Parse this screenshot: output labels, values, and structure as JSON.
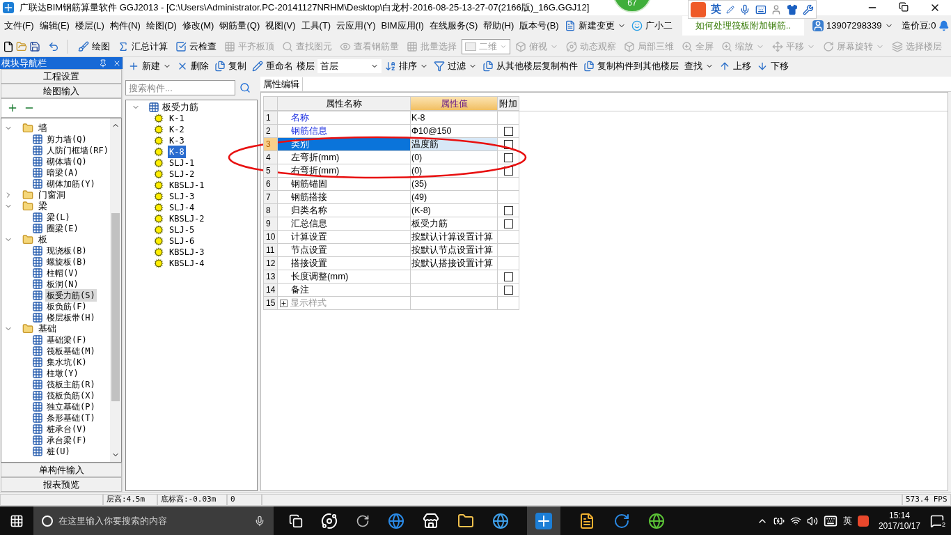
{
  "window": {
    "title": "广联达BIM钢筋算量软件 GGJ2013 - [C:\\Users\\Administrator.PC-20141127NRHM\\Desktop\\白龙村-2016-08-25-13-27-07(2166版)_16G.GGJ12]"
  },
  "badge": "67",
  "ime": {
    "mode": "英"
  },
  "menu": [
    "文件(F)",
    "编辑(E)",
    "楼层(L)",
    "构件(N)",
    "绘图(D)",
    "修改(M)",
    "钢筋量(Q)",
    "视图(V)",
    "工具(T)",
    "云应用(Y)",
    "BIM应用(I)",
    "在线服务(S)",
    "帮助(H)",
    "版本号(B)"
  ],
  "menu_extras": {
    "change": "新建变更",
    "assistant": "广小二",
    "notice": "如何处理筏板附加钢筋..",
    "account": "13907298339",
    "beans": "造价豆:0"
  },
  "toolbar": [
    {
      "kind": "button",
      "label": "绘图",
      "disabled": false
    },
    {
      "kind": "button",
      "label": "汇总计算",
      "disabled": false
    },
    {
      "kind": "button",
      "label": "云检查",
      "disabled": false
    },
    {
      "kind": "button",
      "label": "平齐板顶",
      "disabled": true
    },
    {
      "kind": "button",
      "label": "查找图元",
      "disabled": true
    },
    {
      "kind": "button",
      "label": "查看钢筋量",
      "disabled": true
    },
    {
      "kind": "button",
      "label": "批量选择",
      "disabled": true
    },
    {
      "kind": "select",
      "label": "二维",
      "disabled": true
    },
    {
      "kind": "dropdown",
      "label": "俯视",
      "disabled": true
    },
    {
      "kind": "button",
      "label": "动态观察",
      "disabled": true
    },
    {
      "kind": "button",
      "label": "局部三维",
      "disabled": true
    },
    {
      "kind": "button",
      "label": "全屏",
      "disabled": true
    },
    {
      "kind": "dropdown",
      "label": "缩放",
      "disabled": true
    },
    {
      "kind": "dropdown",
      "label": "平移",
      "disabled": true
    },
    {
      "kind": "dropdown",
      "label": "屏幕旋转",
      "disabled": true
    },
    {
      "kind": "button",
      "label": "选择楼层",
      "disabled": true
    }
  ],
  "nav": {
    "title": "模块导航栏",
    "sections_top": [
      "工程设置",
      "绘图输入"
    ],
    "sections_bottom": [
      "单构件输入",
      "报表预览"
    ],
    "tree": [
      {
        "label": "墙",
        "expanded": true,
        "selected": false,
        "children": [
          {
            "label": "剪力墙(Q)",
            "selected": false
          },
          {
            "label": "人防门框墙(RF)",
            "selected": false
          },
          {
            "label": "砌体墙(Q)",
            "selected": false
          },
          {
            "label": "暗梁(A)",
            "selected": false
          },
          {
            "label": "砌体加筋(Y)",
            "selected": false
          }
        ]
      },
      {
        "label": "门窗洞",
        "expanded": false,
        "selected": false
      },
      {
        "label": "梁",
        "expanded": true,
        "selected": false,
        "children": [
          {
            "label": "梁(L)",
            "selected": false
          },
          {
            "label": "圈梁(E)",
            "selected": false
          }
        ]
      },
      {
        "label": "板",
        "expanded": true,
        "selected": false,
        "children": [
          {
            "label": "现浇板(B)",
            "selected": false
          },
          {
            "label": "螺旋板(B)",
            "selected": false
          },
          {
            "label": "柱帽(V)",
            "selected": false
          },
          {
            "label": "板洞(N)",
            "selected": false
          },
          {
            "label": "板受力筋(S)",
            "selected": true
          },
          {
            "label": "板负筋(F)",
            "selected": false
          },
          {
            "label": "楼层板带(H)",
            "selected": false
          }
        ]
      },
      {
        "label": "基础",
        "expanded": true,
        "selected": false,
        "children": [
          {
            "label": "基础梁(F)",
            "selected": false
          },
          {
            "label": "筏板基础(M)",
            "selected": false
          },
          {
            "label": "集水坑(K)",
            "selected": false
          },
          {
            "label": "柱墩(Y)",
            "selected": false
          },
          {
            "label": "筏板主筋(R)",
            "selected": false
          },
          {
            "label": "筏板负筋(X)",
            "selected": false
          },
          {
            "label": "独立基础(P)",
            "selected": false
          },
          {
            "label": "条形基础(T)",
            "selected": false
          },
          {
            "label": "桩承台(V)",
            "selected": false
          },
          {
            "label": "承台梁(F)",
            "selected": false
          },
          {
            "label": "桩(U)",
            "selected": false
          }
        ]
      }
    ]
  },
  "component_toolbar": {
    "items": [
      {
        "kind": "dropdown",
        "label": "新建"
      },
      {
        "kind": "button",
        "label": "删除"
      },
      {
        "kind": "button",
        "label": "复制"
      },
      {
        "kind": "button",
        "label": "重命名"
      },
      {
        "kind": "floor",
        "label": "楼层",
        "value": "首层"
      },
      {
        "kind": "dropdown",
        "label": "排序"
      },
      {
        "kind": "dropdown",
        "label": "过滤"
      },
      {
        "kind": "button",
        "label": "从其他楼层复制构件"
      },
      {
        "kind": "button",
        "label": "复制构件到其他楼层"
      },
      {
        "kind": "dropdown",
        "label": "查找"
      },
      {
        "kind": "button",
        "label": "上移"
      },
      {
        "kind": "button",
        "label": "下移"
      }
    ]
  },
  "component_list": {
    "search_placeholder": "搜索构件...",
    "root": {
      "label": "板受力筋",
      "expanded": true,
      "children": [
        {
          "label": "K-1",
          "selected": false
        },
        {
          "label": "K-2",
          "selected": false
        },
        {
          "label": "K-3",
          "selected": false
        },
        {
          "label": "K-8",
          "selected": true
        },
        {
          "label": "SLJ-1",
          "selected": false
        },
        {
          "label": "SLJ-2",
          "selected": false
        },
        {
          "label": "KBSLJ-1",
          "selected": false
        },
        {
          "label": "SLJ-3",
          "selected": false
        },
        {
          "label": "SLJ-4",
          "selected": false
        },
        {
          "label": "KBSLJ-2",
          "selected": false
        },
        {
          "label": "SLJ-5",
          "selected": false
        },
        {
          "label": "SLJ-6",
          "selected": false
        },
        {
          "label": "KBSLJ-3",
          "selected": false
        },
        {
          "label": "KBSLJ-4",
          "selected": false
        }
      ]
    }
  },
  "properties": {
    "tab": "属性编辑",
    "columns": [
      "属性名称",
      "属性值",
      "附加"
    ],
    "rows": [
      {
        "num": "1",
        "name": "名称",
        "value": "K-8",
        "kind": "key",
        "selected": false
      },
      {
        "num": "2",
        "name": "钢筋信息",
        "value": "Φ10@150",
        "kind": "key",
        "selected": false,
        "checked": false
      },
      {
        "num": "3",
        "name": "类别",
        "value": "温度筋",
        "kind": "plain",
        "selected": true,
        "checked": false
      },
      {
        "num": "4",
        "name": "左弯折(mm)",
        "value": "(0)",
        "kind": "plain",
        "selected": false,
        "checked": false
      },
      {
        "num": "5",
        "name": "右弯折(mm)",
        "value": "(0)",
        "kind": "plain",
        "selected": false,
        "checked": false
      },
      {
        "num": "6",
        "name": "钢筋锚固",
        "value": "(35)",
        "kind": "plain",
        "selected": false
      },
      {
        "num": "7",
        "name": "钢筋搭接",
        "value": "(49)",
        "kind": "plain",
        "selected": false
      },
      {
        "num": "8",
        "name": "归类名称",
        "value": "(K-8)",
        "kind": "plain",
        "selected": false,
        "checked": false
      },
      {
        "num": "9",
        "name": "汇总信息",
        "value": "板受力筋",
        "kind": "plain",
        "selected": false,
        "checked": false
      },
      {
        "num": "10",
        "name": "计算设置",
        "value": "按默认计算设置计算",
        "kind": "plain",
        "selected": false
      },
      {
        "num": "11",
        "name": "节点设置",
        "value": "按默认节点设置计算",
        "kind": "plain",
        "selected": false
      },
      {
        "num": "12",
        "name": "搭接设置",
        "value": "按默认搭接设置计算",
        "kind": "plain",
        "selected": false
      },
      {
        "num": "13",
        "name": "长度调整(mm)",
        "kind": "plain",
        "selected": false,
        "checked": false
      },
      {
        "num": "14",
        "name": "备注",
        "kind": "plain",
        "selected": false,
        "checked": false
      },
      {
        "num": "15",
        "name": "显示样式",
        "kind": "group",
        "expanded": false,
        "selected": false
      }
    ]
  },
  "status_bar": {
    "floor_height": "层高:4.5m",
    "base_elevation": "底标高:-0.03m",
    "field_3": "0",
    "fps": "573.4 FPS"
  },
  "taskbar": {
    "search_placeholder": "在这里输入你要搜索的内容",
    "ime": "英",
    "time": "15:14",
    "date": "2017/10/17",
    "notifications": "2"
  }
}
